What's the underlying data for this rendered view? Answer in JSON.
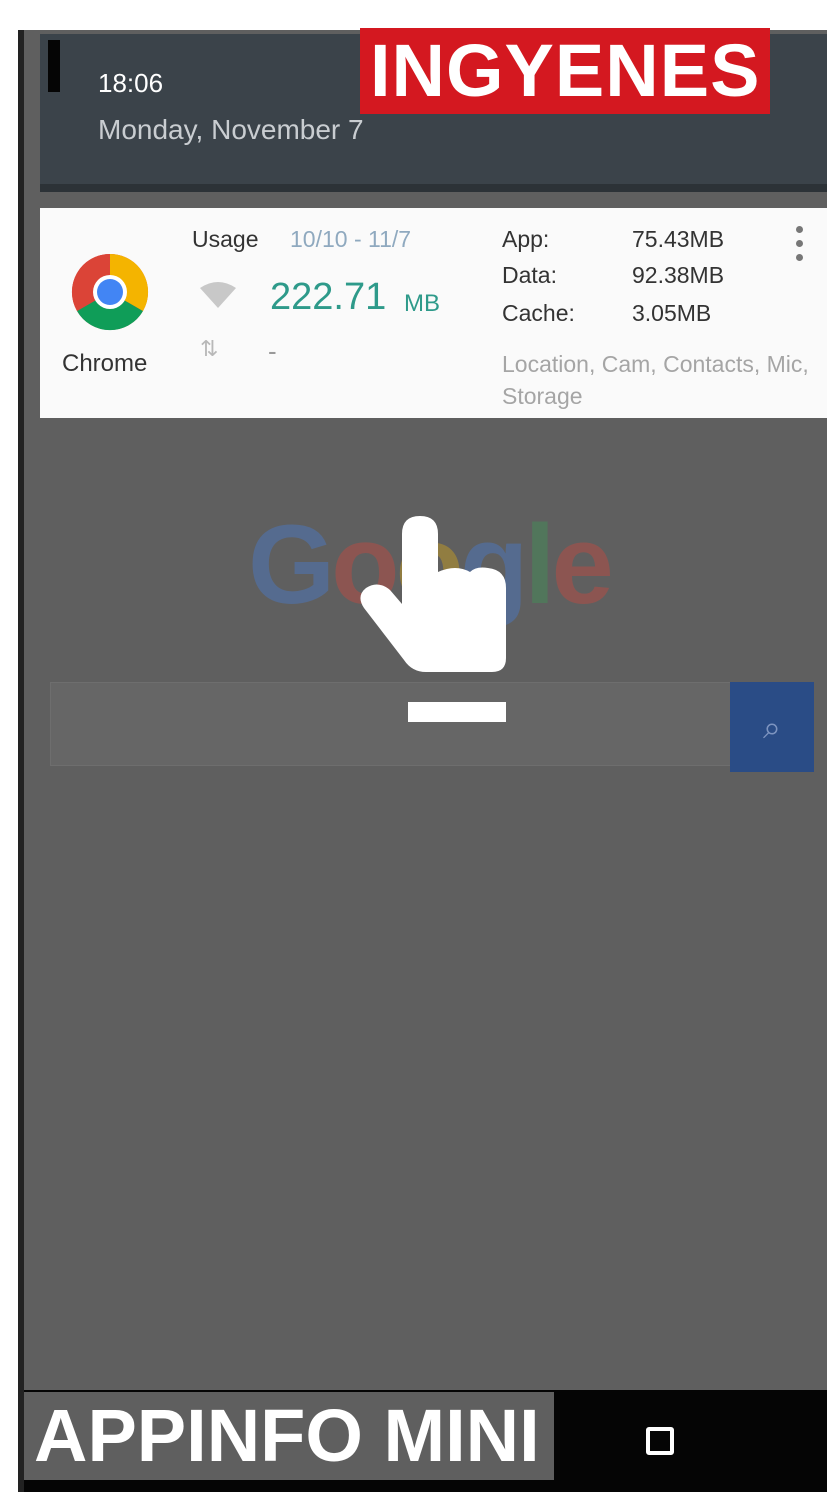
{
  "header": {
    "time": "18:06",
    "date": "Monday, November 7"
  },
  "banners": {
    "top": "INGYENES",
    "bottom": "APPINFO MINI"
  },
  "app_card": {
    "app_name": "Chrome",
    "usage_label": "Usage",
    "usage_range": "10/10 - 11/7",
    "wifi_usage": "222.71",
    "wifi_unit": "MB",
    "mobile_usage": "-",
    "stats": [
      {
        "label": "App:",
        "value": "75.43MB"
      },
      {
        "label": "Data:",
        "value": "92.38MB"
      },
      {
        "label": "Cache:",
        "value": "3.05MB"
      }
    ],
    "permissions": "Location, Cam, Contacts, Mic, Storage"
  },
  "background_page": {
    "logo_letters": [
      "G",
      "o",
      "o",
      "g",
      "l",
      "e"
    ],
    "logo_colors": [
      "#4285f4",
      "#ea4335",
      "#fbbc05",
      "#4285f4",
      "#34a853",
      "#ea4335"
    ],
    "search_icon": "⌕"
  },
  "icons": {
    "overflow": "more-vert-icon",
    "wifi": "wifi-icon",
    "mobile": "mobile-data-icon",
    "hand": "tap-hand-icon",
    "recents": "recents-square-icon"
  },
  "colors": {
    "banner_red": "#d41820",
    "usage_teal": "#2e9a8a",
    "header_bg": "#3b434a",
    "overlay_gray": "#5f5f5f"
  }
}
